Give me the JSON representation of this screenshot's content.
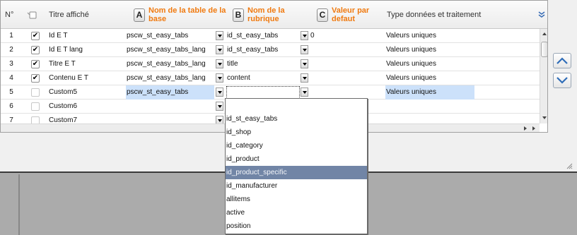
{
  "header": {
    "num": "N°",
    "titre": "Titre affiché",
    "col_a": {
      "letter": "A",
      "label": "Nom de la table de la base"
    },
    "col_b": {
      "letter": "B",
      "label": "Nom de la rubrique"
    },
    "col_c": {
      "letter": "C",
      "label": "Valeur par defaut"
    },
    "type": "Type données et traitement"
  },
  "rows": [
    {
      "num": "1",
      "checked": "✔",
      "titre": "Id E T",
      "table": "pscw_st_easy_tabs",
      "rubrique": "id_st_easy_tabs",
      "defaut": "0",
      "type": "Valeurs uniques"
    },
    {
      "num": "2",
      "checked": "✔",
      "titre": "Id E T lang",
      "table": "pscw_st_easy_tabs_lang",
      "rubrique": "id_st_easy_tabs",
      "defaut": "",
      "type": "Valeurs uniques"
    },
    {
      "num": "3",
      "checked": "✔",
      "titre": "Titre E T",
      "table": "pscw_st_easy_tabs_lang",
      "rubrique": "title",
      "defaut": "",
      "type": "Valeurs uniques"
    },
    {
      "num": "4",
      "checked": "✔",
      "titre": "Contenu E T",
      "table": "pscw_st_easy_tabs_lang",
      "rubrique": "content",
      "defaut": "",
      "type": "Valeurs uniques"
    },
    {
      "num": "5",
      "checked": "",
      "titre": "Custom5",
      "table": "pscw_st_easy_tabs",
      "rubrique": "",
      "defaut": "",
      "type": "Valeurs uniques"
    },
    {
      "num": "6",
      "checked": "",
      "titre": "Custom6",
      "table": "",
      "rubrique": "",
      "defaut": "",
      "type": ""
    },
    {
      "num": "7",
      "checked": "",
      "titre": "Custom7",
      "table": "",
      "rubrique": "",
      "defaut": "",
      "type": ""
    }
  ],
  "dropdown": {
    "items": [
      "",
      "id_st_easy_tabs",
      "id_shop",
      "id_category",
      "id_product",
      "id_product_specific",
      "id_manufacturer",
      "allitems",
      "active",
      "position"
    ],
    "highlighted": "id_product_specific"
  },
  "colors": {
    "header_accent": "#f07a10",
    "highlight": "#7185a6",
    "selected_cell": "#cce1fa"
  },
  "icons": [
    "column-menu-icon",
    "scroll-up-icon",
    "scroll-down-icon",
    "checkbox-header-icon"
  ]
}
